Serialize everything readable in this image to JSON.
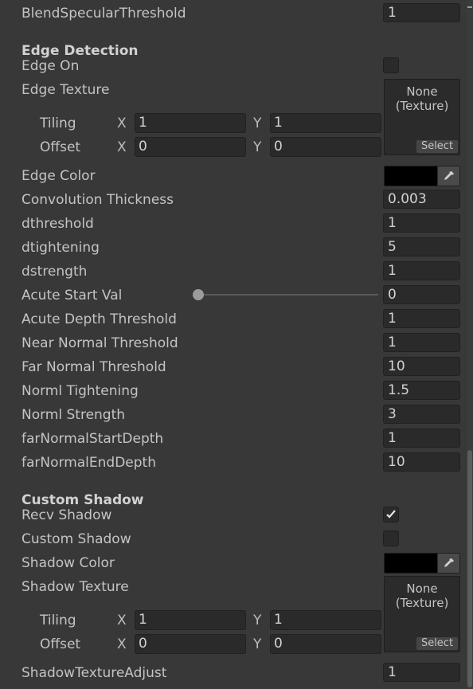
{
  "top": {
    "label": "BlendSpecularThreshold",
    "value": "1"
  },
  "edge": {
    "header": "Edge Detection",
    "edge_on": {
      "label": "Edge On",
      "checked": false
    },
    "texture": {
      "label": "Edge Texture",
      "line1": "None",
      "line2": "(Texture)",
      "select": "Select"
    },
    "tiling": {
      "label": "Tiling",
      "x_label": "X",
      "x": "1",
      "y_label": "Y",
      "y": "1"
    },
    "offset": {
      "label": "Offset",
      "x_label": "X",
      "x": "0",
      "y_label": "Y",
      "y": "0"
    },
    "color": {
      "label": "Edge Color",
      "value": "#000000"
    },
    "rows": [
      {
        "label": "Convolution Thickness",
        "value": "0.003"
      },
      {
        "label": "dthreshold",
        "value": "1"
      },
      {
        "label": "dtightening",
        "value": "5"
      },
      {
        "label": "dstrength",
        "value": "1"
      }
    ],
    "acute_start": {
      "label": "Acute Start Val",
      "value": "0",
      "slider_fraction": 0
    },
    "rows2": [
      {
        "label": "Acute Depth Threshold",
        "value": "1"
      },
      {
        "label": "Near Normal Threshold",
        "value": "1"
      },
      {
        "label": "Far Normal Threshold",
        "value": "10"
      },
      {
        "label": "Norml Tightening",
        "value": "1.5"
      },
      {
        "label": "Norml Strength",
        "value": "3"
      },
      {
        "label": "farNormalStartDepth",
        "value": "1"
      },
      {
        "label": "farNormalEndDepth",
        "value": "10"
      }
    ]
  },
  "shadow": {
    "header": "Custom Shadow",
    "recv": {
      "label": "Recv Shadow",
      "checked": true
    },
    "custom": {
      "label": "Custom Shadow",
      "checked": false
    },
    "color": {
      "label": "Shadow Color",
      "value": "#000000"
    },
    "texture": {
      "label": "Shadow Texture",
      "line1": "None",
      "line2": "(Texture)",
      "select": "Select"
    },
    "tiling": {
      "label": "Tiling",
      "x_label": "X",
      "x": "1",
      "y_label": "Y",
      "y": "1"
    },
    "offset": {
      "label": "Offset",
      "x_label": "X",
      "x": "0",
      "y_label": "Y",
      "y": "0"
    },
    "adjust": {
      "label": "ShadowTextureAdjust",
      "value": "1"
    }
  }
}
